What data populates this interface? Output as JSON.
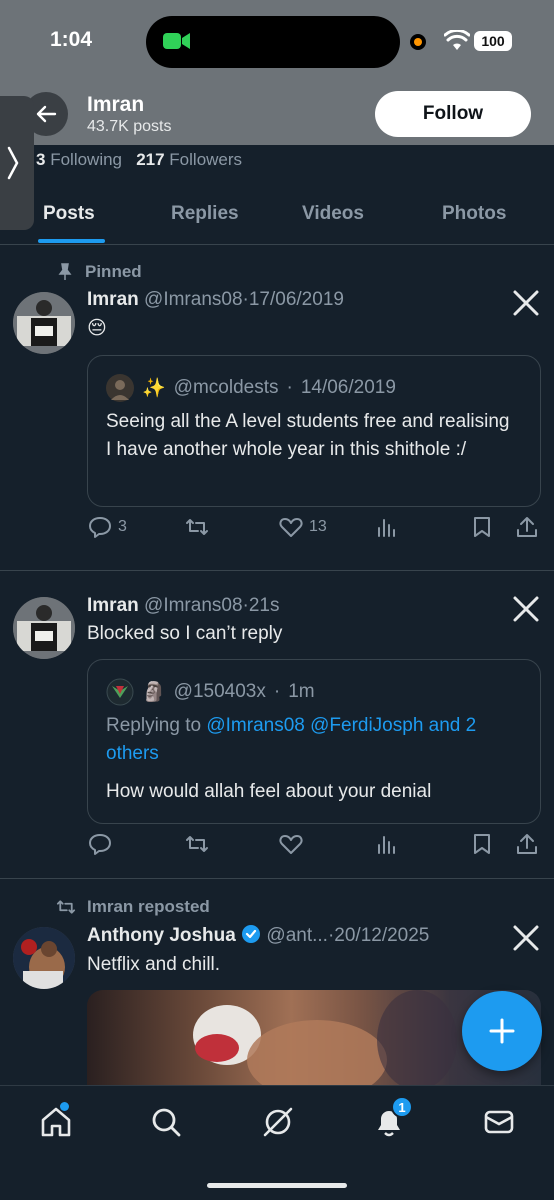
{
  "status_bar": {
    "time": "1:04",
    "battery": "100"
  },
  "profile": {
    "name": "Imran",
    "posts_count": "43.7K posts",
    "follow_label": "Follow",
    "following_count": "3",
    "following_label": "Following",
    "followers_count": "217",
    "followers_label": "Followers"
  },
  "tabs": [
    {
      "label": "Posts",
      "active": true
    },
    {
      "label": "Replies",
      "active": false
    },
    {
      "label": "Videos",
      "active": false
    },
    {
      "label": "Photos",
      "active": false
    }
  ],
  "posts": [
    {
      "context": "Pinned",
      "name": "Imran",
      "handle": "@Imrans08",
      "date": "17/06/2019",
      "text": "😔",
      "quote": {
        "handle": "@mcoldests",
        "date": "14/06/2019",
        "emoji": "✨",
        "text": "Seeing all the A level students free and realising I have another whole year in this shithole :/"
      },
      "stats": {
        "replies": "3",
        "retweets": "",
        "likes": "13"
      }
    },
    {
      "name": "Imran",
      "handle": "@Imrans08",
      "date": "21s",
      "text": "Blocked so I can’t reply",
      "quote": {
        "handle": "@150403x",
        "date": "1m",
        "emoji": "🗿",
        "replying_prefix": "Replying to",
        "replying_to": "@Imrans08 @FerdiJosph and 2 others",
        "text": "How would allah feel about your denial"
      },
      "stats": {
        "replies": "",
        "retweets": "",
        "likes": ""
      }
    },
    {
      "context": "Imran reposted",
      "name": "Anthony Joshua",
      "handle": "@ant...",
      "date": "20/12/2025",
      "text": "Netflix and chill."
    }
  ],
  "nav": {
    "notifications_badge": "1"
  },
  "colors": {
    "accent": "#1d9bf0",
    "background": "#15202b",
    "muted": "#8b98a5"
  }
}
